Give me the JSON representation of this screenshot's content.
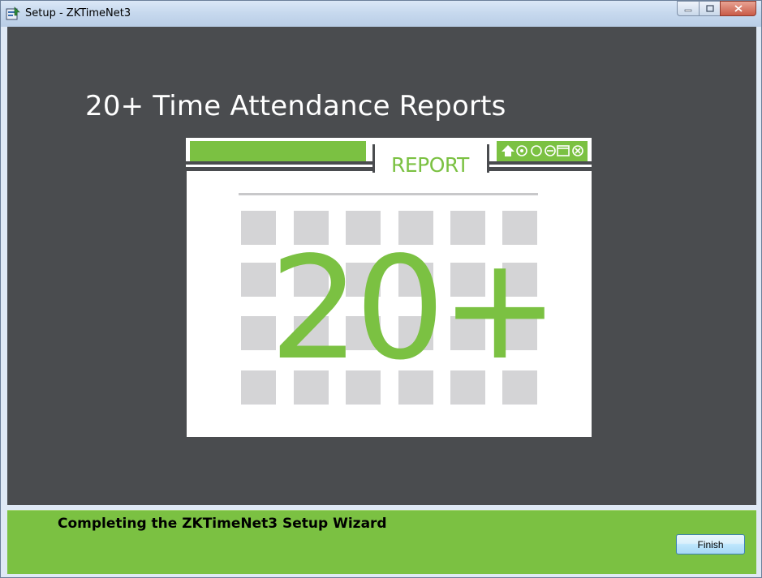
{
  "window": {
    "title": "Setup - ZKTimeNet3"
  },
  "banner": {
    "headline": "20+ Time Attendance Reports",
    "report_tab_label": "REPORT",
    "big_number": "20+"
  },
  "footer": {
    "heading": "Completing the ZKTimeNet3 Setup Wizard",
    "finish_label": "Finish"
  },
  "colors": {
    "accent_green": "#7bc142",
    "dark_background": "#4a4c4f",
    "tile_gray": "#d4d4d6"
  },
  "icons": [
    "home-icon",
    "settings-icon",
    "help-icon",
    "minus-icon",
    "window-icon",
    "close-icon"
  ]
}
